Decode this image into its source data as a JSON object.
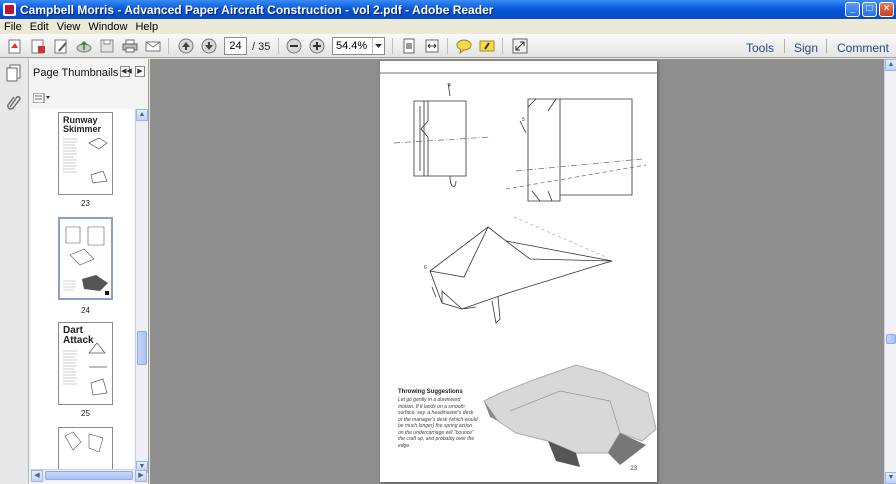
{
  "window": {
    "title": "Campbell Morris - Advanced Paper Aircraft Construction - vol 2.pdf - Adobe Reader",
    "minimize_icon": "minimize-icon",
    "maximize_icon": "maximize-icon",
    "close_icon": "close-icon"
  },
  "menu": [
    "File",
    "Edit",
    "View",
    "Window",
    "Help"
  ],
  "toolbar": {
    "current_page": "24",
    "total_pages": "/ 35",
    "zoom": "54.4%",
    "tools_label": "Tools",
    "sign_label": "Sign",
    "comment_label": "Comment"
  },
  "thumbnails": {
    "header": "Page Thumbnails",
    "pages": [
      {
        "label": "23",
        "heading": "Runway Skimmer"
      },
      {
        "label": "24",
        "heading": ""
      },
      {
        "label": "25",
        "heading": "Dart Attack"
      }
    ]
  },
  "document": {
    "throw_title": "Throwing Suggestions",
    "throw_body": "Let go gently in a downward motion. If it lands on a smooth surface, say, a headmaster's desk or the manager's desk (which would be much longer) the spring action on the undercarriage will \"bounce\" the craft up, and probably over the edge.",
    "page_number": "23",
    "diagram_labels": [
      "4",
      "5",
      "6"
    ]
  },
  "colors": {
    "titlebar": "#0a5adc",
    "doc_background": "#8f8f8f",
    "accent_text": "#2a4a7a"
  }
}
